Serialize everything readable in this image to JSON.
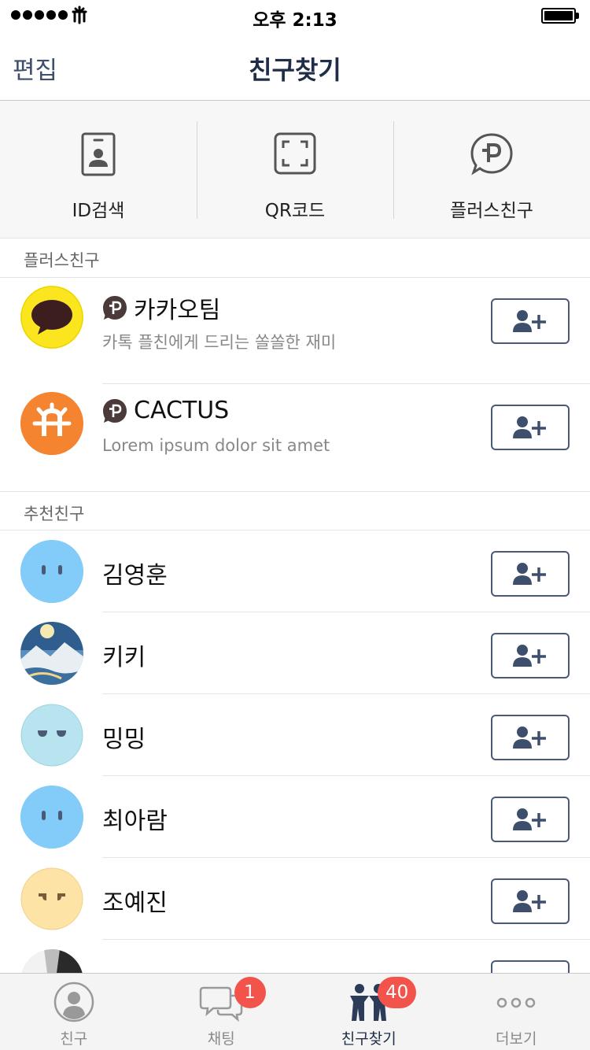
{
  "status_bar": {
    "time": "오후 2:13"
  },
  "nav": {
    "edit_label": "편집",
    "title": "친구찾기"
  },
  "quick_actions": [
    {
      "label": "ID검색",
      "icon": "id-card-icon"
    },
    {
      "label": "QR코드",
      "icon": "qr-scan-icon"
    },
    {
      "label": "플러스친구",
      "icon": "plus-friend-icon"
    }
  ],
  "plus_friends": {
    "header": "플러스친구",
    "items": [
      {
        "name": "카카오팀",
        "desc": "카톡 플친에게 드리는 쏠쏠한 재미"
      },
      {
        "name": "CACTUS",
        "desc": "Lorem ipsum dolor sit amet"
      }
    ]
  },
  "recommended": {
    "header": "추천친구",
    "items": [
      {
        "name": "김영훈",
        "avatar": "blue-face"
      },
      {
        "name": "키키",
        "avatar": "photo-landscape"
      },
      {
        "name": "밍밍",
        "avatar": "lightblue-face"
      },
      {
        "name": "최아람",
        "avatar": "blue-face"
      },
      {
        "name": "조예진",
        "avatar": "yellow-face"
      }
    ]
  },
  "tabs": [
    {
      "label": "친구",
      "icon": "person-icon",
      "badge": ""
    },
    {
      "label": "채팅",
      "icon": "chat-bubbles-icon",
      "badge": "1"
    },
    {
      "label": "친구찾기",
      "icon": "find-friends-icon",
      "badge": "40"
    },
    {
      "label": "더보기",
      "icon": "more-icon",
      "badge": ""
    }
  ],
  "colors": {
    "accent": "#1f2d47",
    "badge": "#f2544b",
    "button_border": "#4a5a75"
  }
}
